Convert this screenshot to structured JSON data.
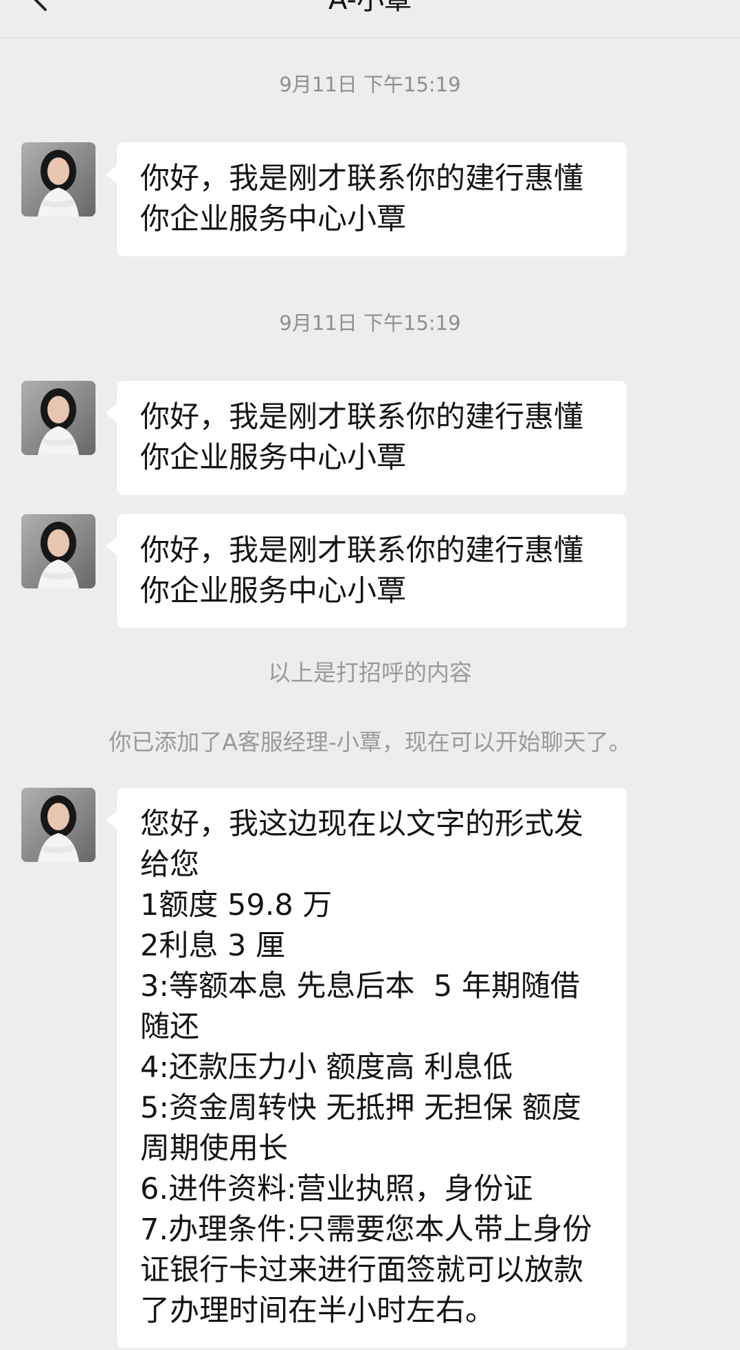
{
  "header": {
    "title": "A-小覃"
  },
  "timestamps": {
    "first": "9月11日 下午15:19",
    "second": "9月11日 下午15:19"
  },
  "messages": [
    {
      "text": "你好，我是刚才联系你的建行惠懂你企业服务中心小覃"
    },
    {
      "text": "你好，我是刚才联系你的建行惠懂你企业服务中心小覃"
    },
    {
      "text": "你好，我是刚才联系你的建行惠懂你企业服务中心小覃"
    },
    {
      "text": "您好，我这边现在以文字的形式发给您\n1额度 59.8 万\n2利息 3 厘\n3:等额本息 先息后本  5 年期随借随还\n4:还款压力小 额度高 利息低\n5:资金周转快 无抵押 无担保 额度周期使用长\n6.进件资料:营业执照，身份证\n7.办理条件:只需要您本人带上身份证银行卡过来进行面签就可以放款了办理时间在半小时左右。"
    }
  ],
  "system_notes": {
    "greeting_note": "以上是打招呼的内容",
    "added_note": "你已添加了A客服经理-小覃，现在可以开始聊天了。"
  }
}
